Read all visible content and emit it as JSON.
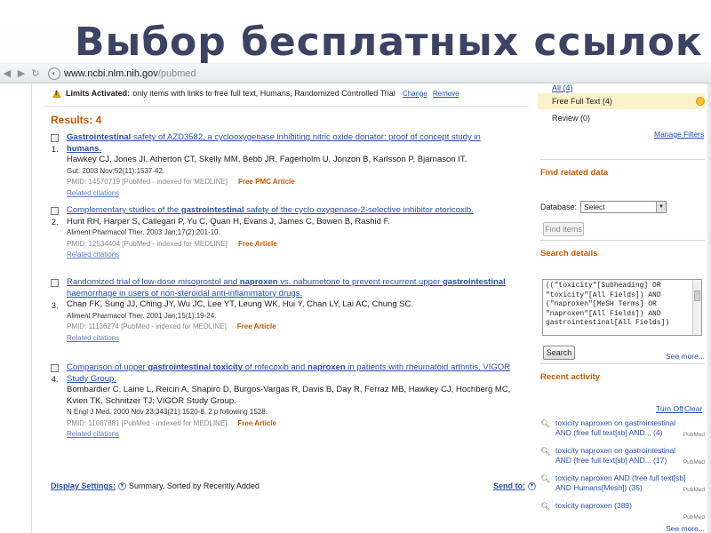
{
  "slide": {
    "title": "Выбор бесплатных ссылок"
  },
  "browser": {
    "url_host": "www.ncbi.nlm.nih.gov",
    "url_path": "/pubmed",
    "back_glyph": "◀",
    "forward_glyph": "▶",
    "reload_glyph": "↻"
  },
  "limits": {
    "label": "Limits Activated:",
    "text": "only items with links to free full text, Humans, Randomized Controlled Trial",
    "change": "Change",
    "remove": "Remove"
  },
  "results_count": "Results: 4",
  "results": [
    {
      "num": "1.",
      "title_parts": [
        "",
        "Gastrointestinal",
        " safety of AZD3582, a cyclooxygenase inhibiting nitric oxide donator: proof of concept study in ",
        "humans",
        "."
      ],
      "authors": "Hawkey CJ, Jones JI, Atherton CT, Skelly MM, Bebb JR, Fagerholm U, Jonzon B, Karlsson P, Bjarnason IT.",
      "journal": "Gut. 2003 Nov;52(11):1537-42.",
      "pmid": "PMID: 14570719 [PubMed - indexed for MEDLINE]",
      "free": "Free PMC Article",
      "related": "Related citations"
    },
    {
      "num": "2.",
      "title_parts": [
        "Complementary studies of the ",
        "gastrointestinal",
        " safety of the cyclo-oxygenase-2-selective inhibitor etoricoxib.",
        "",
        ""
      ],
      "authors": "Hunt RH, Harper S, Callegari P, Yu C, Quan H, Evans J, James C, Bowen B, Rashid F.",
      "journal": "Aliment Pharmacol Ther. 2003 Jan;17(2):201-10.",
      "pmid": "PMID: 12534404 [PubMed - indexed for MEDLINE]",
      "free": "Free Article",
      "related": "Related citations"
    },
    {
      "num": "3.",
      "title_parts": [
        "Randomized trial of low-dose misoprostol and ",
        "naproxen",
        " vs. nabumetone to prevent recurrent upper ",
        "gastrointestinal",
        " haemorrhage in users of non-steroidal anti-inflammatory drugs."
      ],
      "authors": "Chan FK, Sung JJ, Ching JY, Wu JC, Lee YT, Leung WK, Hui Y, Chan LY, Lai AC, Chung SC.",
      "journal": "Aliment Pharmacol Ther. 2001 Jan;15(1):19-24.",
      "pmid": "PMID: 11136274 [PubMed - indexed for MEDLINE]",
      "free": "Free Article",
      "related": "Related citations"
    },
    {
      "num": "4.",
      "title_parts": [
        "Comparison of upper ",
        "gastrointestinal toxicity",
        " of rofecoxib and ",
        "naproxen",
        " in patients with rheumatoid arthritis. VIGOR Study Group."
      ],
      "authors": "Bombardier C, Laine L, Reicin A, Shapiro D, Burgos-Vargas R, Davis B, Day R, Ferraz MB, Hawkey CJ, Hochberg MC, Kvien TK, Schnitzer TJ; VIGOR Study Group.",
      "journal": "N Engl J Med. 2000 Nov 23;343(21):1520-8, 2 p following 1528.",
      "pmid": "PMID: 11087881 [PubMed - indexed for MEDLINE]",
      "free": "Free Article",
      "related": "Related citations"
    }
  ],
  "display_settings": {
    "label": "Display Settings:",
    "value": "Summary, Sorted by Recently Added"
  },
  "send_to": "Send to:",
  "sidebar": {
    "all": "All (4)",
    "free_full_text": "Free Full Text (4)",
    "review": "Review (0)",
    "manage_filters": "Manage Filters",
    "find_related": {
      "heading": "Find related data",
      "database_label": "Database:",
      "database_value": "Select",
      "find_items": "Find items"
    },
    "search_details": {
      "heading": "Search details",
      "query": "((\"toxicity\"[Subheading] OR \"toxicity\"[All Fields]) AND (\"naproxen\"[MeSH Terms] OR \"naproxen\"[All Fields]) AND gastrointestinal[All Fields])",
      "search_button": "Search",
      "see_more": "See more..."
    },
    "recent_activity": {
      "heading": "Recent activity",
      "turn_off": "Turn Off",
      "clear": "Clear",
      "items": [
        {
          "text": "toxicity naproxen on gastrointestinal AND (free full text[sb] AND... (4)",
          "source": "PubMed"
        },
        {
          "text": "toxicity naproxen on gastrointestinal AND (free full text[sb] AND... (17)",
          "source": "PubMed"
        },
        {
          "text": "toxicity naproxen AND (free full text[sb] AND Humans[Mesh]) (35)",
          "source": "PubMed"
        },
        {
          "text": "toxicity naproxen (389)",
          "source": "PubMed"
        }
      ],
      "see_more": "See more..."
    }
  },
  "colors": {
    "title": "#3d4463",
    "link": "#2a4db0",
    "accent_orange": "#c85a00",
    "highlight": "#fcf2c9"
  }
}
